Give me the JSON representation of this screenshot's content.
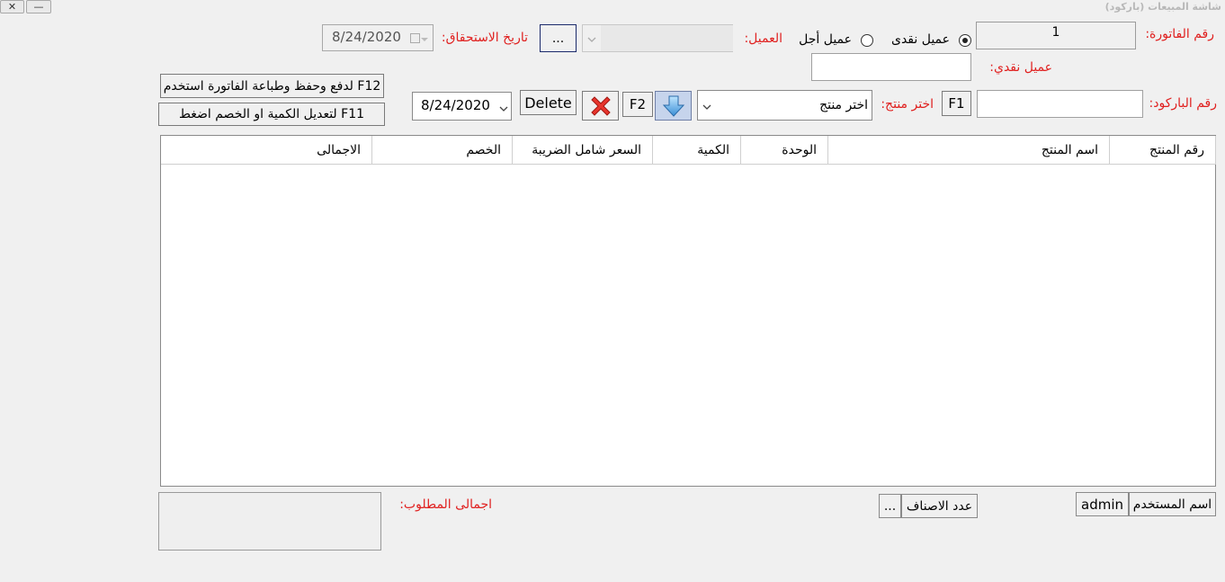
{
  "window": {
    "title": "شاشة المبيعات (باركود)",
    "close_symbol": "✕",
    "minimize_symbol": "—"
  },
  "invoice": {
    "label": "رقم الفاتورة:",
    "value": "1"
  },
  "customer_type": {
    "cash_label": "عميل نقدى",
    "credit_label": "عميل أجل",
    "selected": "cash"
  },
  "customer": {
    "label": "العميل:",
    "value": "",
    "browse_label": "..."
  },
  "due_date": {
    "label": "تاريخ الاستحقاق:",
    "value": "8/24/2020"
  },
  "cash_customer": {
    "label": "عميل نقدي:",
    "value": ""
  },
  "hints": {
    "f12": "لدفع وحفظ وطباعة الفاتورة استخدم F12",
    "f11": "لتعديل الكمية او الخصم اضغط F11"
  },
  "barcode": {
    "label": "رقم الباركود:",
    "value": "",
    "f1_label": "F1"
  },
  "product": {
    "label": "اختر منتج:",
    "placeholder": "اختر منتج",
    "f2_label": "F2"
  },
  "toolbar": {
    "delete_label": "Delete",
    "date_value": "8/24/2020"
  },
  "table": {
    "columns": [
      "رقم المنتج",
      "اسم المنتج",
      "الوحدة",
      "الكمية",
      "السعر شامل الضريبة",
      "الخصم",
      "الاجمالى"
    ],
    "rows": []
  },
  "footer": {
    "user_label": "اسم المستخدم",
    "user_value": "admin",
    "items_count_label": "عدد الاصناف",
    "items_count_value": "...",
    "total_label": "اجمالى المطلوب:",
    "total_value": ""
  },
  "colors": {
    "label_red": "#e0201f",
    "background": "#f0f0f0"
  }
}
